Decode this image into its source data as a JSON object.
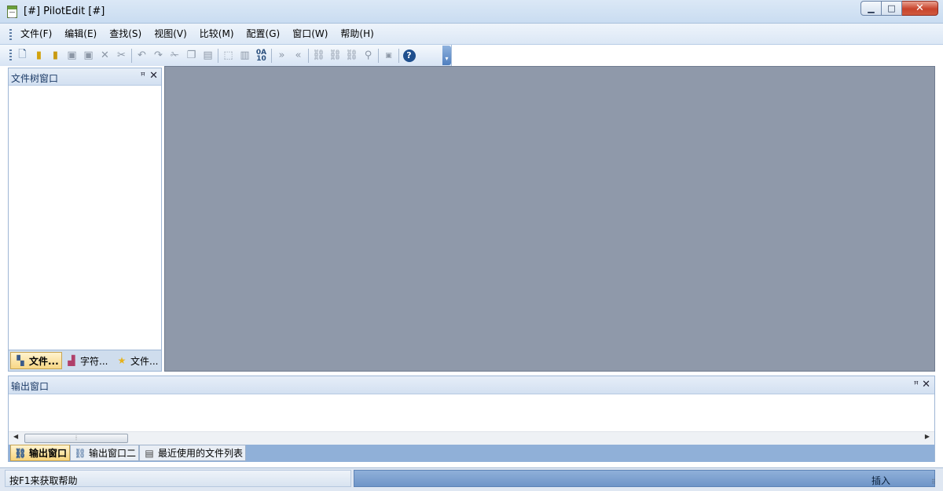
{
  "window": {
    "title": "[#] PilotEdit [#]"
  },
  "menu": [
    "文件(F)",
    "编辑(E)",
    "查找(S)",
    "视图(V)",
    "比较(M)",
    "配置(G)",
    "窗口(W)",
    "帮助(H)"
  ],
  "toolbar": {
    "icons": [
      "new-file-icon",
      "open-file-icon",
      "open-folder-icon",
      "save-icon",
      "save-all-icon",
      "close-file-icon",
      "cut-icon",
      "undo-icon",
      "redo-icon",
      "scissors-icon",
      "copy-icon",
      "paste-icon",
      "select-icon",
      "replace-icon",
      "hex-icon",
      "indent-icon",
      "unindent-icon",
      "compare-icon",
      "merge-icon",
      "sync-icon",
      "diff-icon",
      "hex-mode-icon",
      "help-icon"
    ]
  },
  "left_panel": {
    "title": "文件树窗口",
    "tabs": [
      "文件...",
      "字符...",
      "文件..."
    ]
  },
  "output_panel": {
    "title": "输出窗口",
    "tabs": [
      "输出窗口",
      "输出窗口二",
      "最近使用的文件列表"
    ]
  },
  "status": {
    "help_text": "按F1来获取帮助",
    "mode": "插入"
  }
}
